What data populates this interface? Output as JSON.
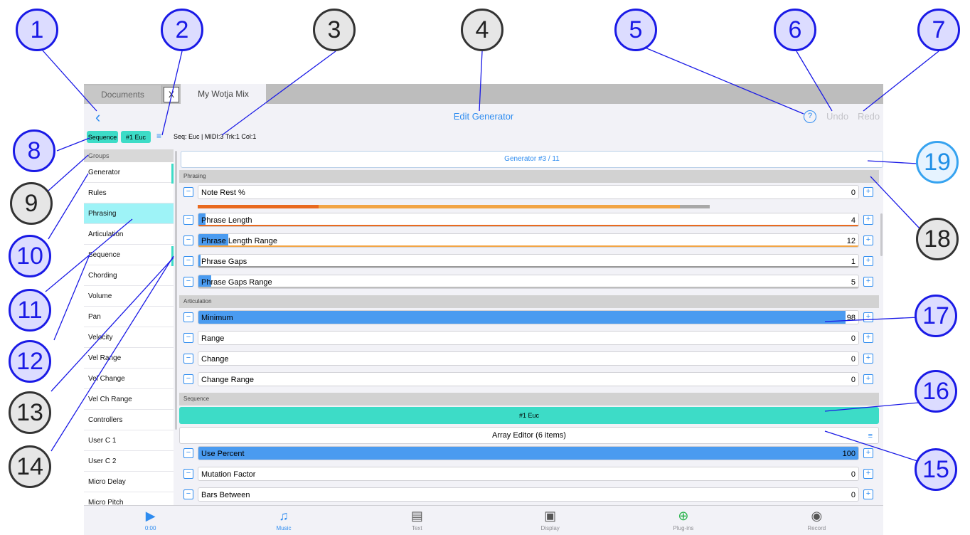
{
  "tabs": {
    "documents_label": "Documents",
    "close_label": "X",
    "active_label": "My Wotja Mix"
  },
  "nav": {
    "title": "Edit Generator",
    "help": "?",
    "undo": "Undo",
    "redo": "Redo"
  },
  "seq_bar": {
    "sequence_pill": "Sequence",
    "euc_pill": "#1 Euc",
    "info": "Seq: Euc | MIDI:3 Trk:1 Col:1"
  },
  "sidebar": {
    "header": "Groups",
    "items": [
      {
        "label": "Generator"
      },
      {
        "label": "Rules"
      },
      {
        "label": "Phrasing"
      },
      {
        "label": "Articulation"
      },
      {
        "label": "Sequence"
      },
      {
        "label": "Chording"
      },
      {
        "label": "Volume"
      },
      {
        "label": "Pan"
      },
      {
        "label": "Velocity"
      },
      {
        "label": "Vel Range"
      },
      {
        "label": "Vel Change"
      },
      {
        "label": "Vel Ch Range"
      },
      {
        "label": "Controllers"
      },
      {
        "label": "User C 1"
      },
      {
        "label": "User C 2"
      },
      {
        "label": "Micro Delay"
      },
      {
        "label": "Micro Pitch"
      }
    ]
  },
  "content": {
    "generator_header": "Generator #3 / 11",
    "phrasing": {
      "title": "Phrasing",
      "note_rest": {
        "label": "Note Rest %",
        "value": "0"
      },
      "rows": [
        {
          "label": "Phrase Length",
          "value": "4"
        },
        {
          "label": "Phrase Length Range",
          "value": "12"
        },
        {
          "label": "Phrase Gaps",
          "value": "1"
        },
        {
          "label": "Phrase Gaps Range",
          "value": "5"
        }
      ]
    },
    "articulation": {
      "title": "Articulation",
      "rows": [
        {
          "label": "Minimum",
          "value": "98"
        },
        {
          "label": "Range",
          "value": "0"
        },
        {
          "label": "Change",
          "value": "0"
        },
        {
          "label": "Change Range",
          "value": "0"
        }
      ]
    },
    "sequence": {
      "title": "Sequence",
      "selected": "#1 Euc",
      "array_editor": "Array Editor (6 items)",
      "rows": [
        {
          "label": "Use Percent",
          "value": "100"
        },
        {
          "label": "Mutation Factor",
          "value": "0"
        },
        {
          "label": "Bars Between",
          "value": "0"
        }
      ]
    }
  },
  "tabbar": {
    "items": [
      {
        "label": "0:00",
        "icon": "play-icon"
      },
      {
        "label": "Music",
        "icon": "music-note-icon"
      },
      {
        "label": "Text",
        "icon": "document-icon"
      },
      {
        "label": "Display",
        "icon": "image-icon"
      },
      {
        "label": "Plug-ins",
        "icon": "plug-in-icon"
      },
      {
        "label": "Record",
        "icon": "record-icon"
      }
    ]
  },
  "callouts": [
    "1",
    "2",
    "3",
    "4",
    "5",
    "6",
    "7",
    "8",
    "9",
    "10",
    "11",
    "12",
    "13",
    "14",
    "15",
    "16",
    "17",
    "18",
    "19"
  ],
  "colors": {
    "accent": "#2e8cf0",
    "teal": "#3ddcc7",
    "selected_row": "#9ef3f7",
    "callout_blue": "#1a1ae6"
  }
}
